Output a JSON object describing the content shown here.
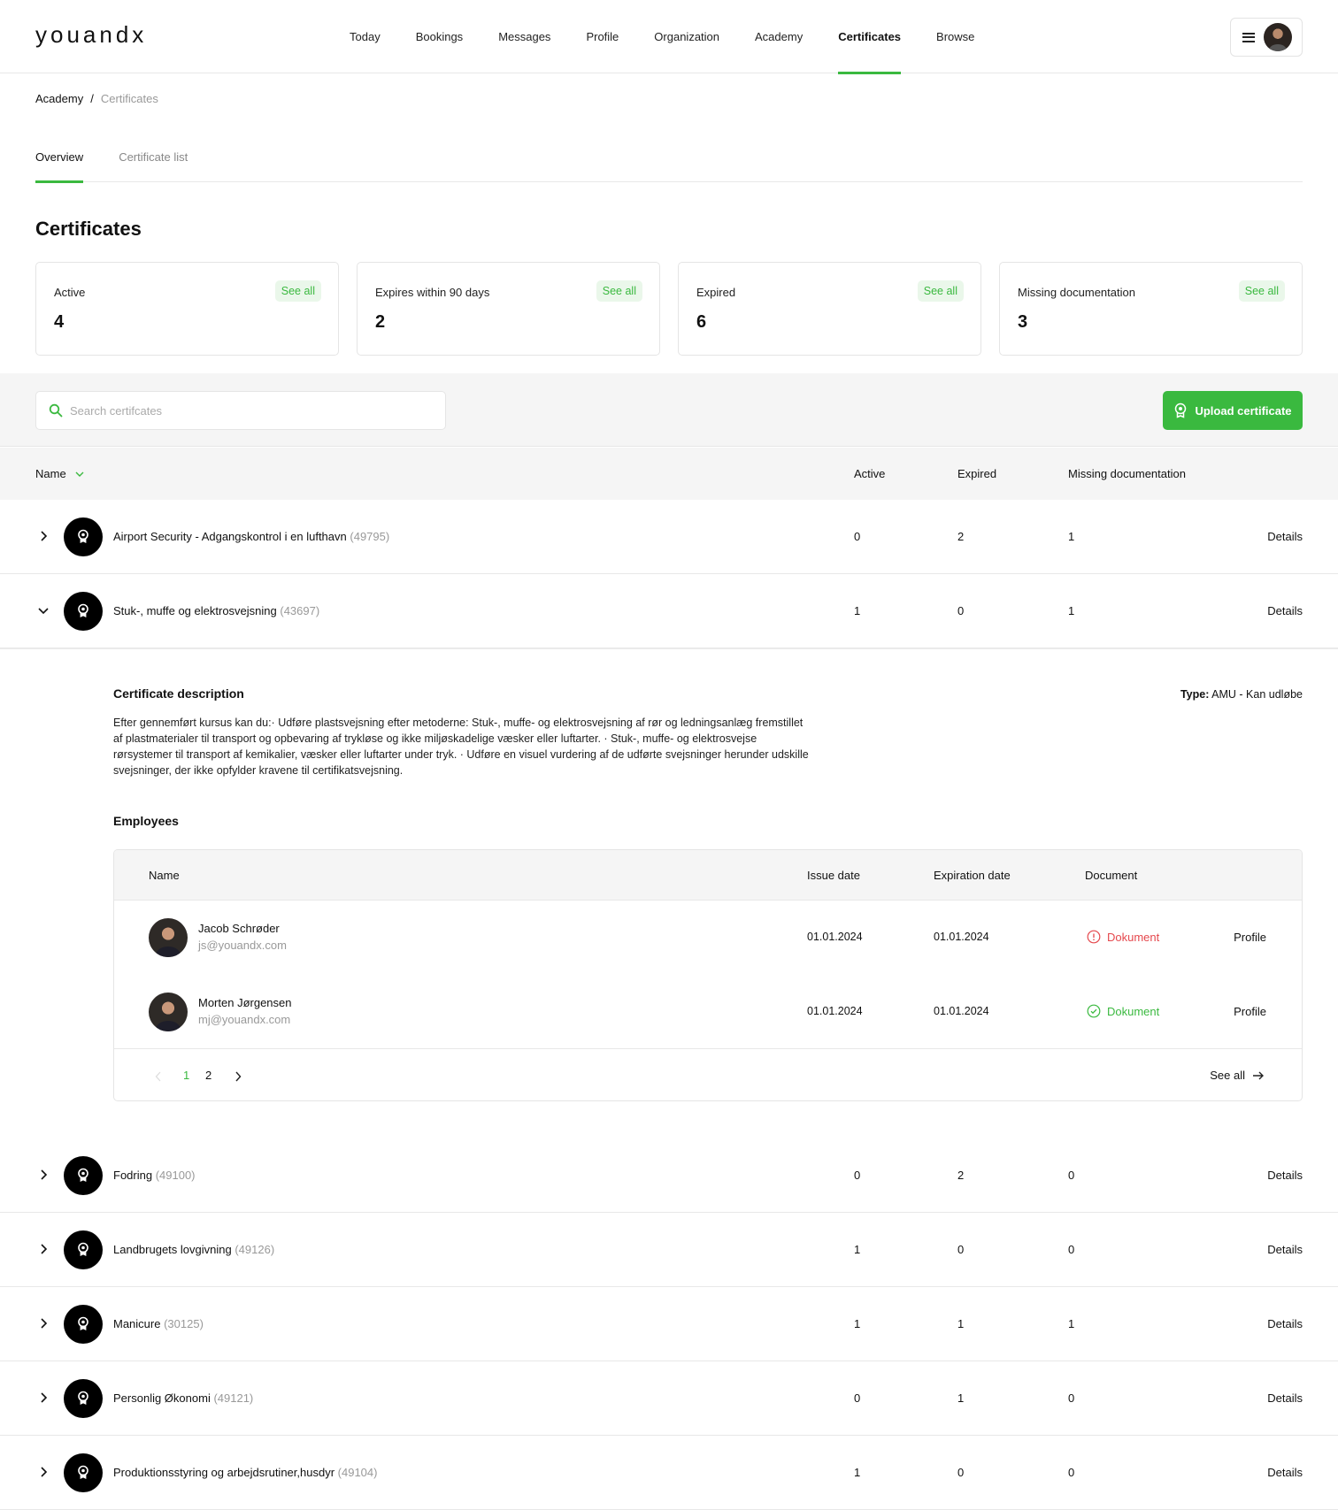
{
  "app": {
    "logo": "youandx"
  },
  "nav": {
    "items": [
      {
        "label": "Today"
      },
      {
        "label": "Bookings"
      },
      {
        "label": "Messages"
      },
      {
        "label": "Profile"
      },
      {
        "label": "Organization"
      },
      {
        "label": "Academy"
      },
      {
        "label": "Certificates",
        "active": true
      },
      {
        "label": "Browse"
      }
    ]
  },
  "breadcrumb": {
    "parent": "Academy",
    "separator": "/",
    "current": "Certificates"
  },
  "tabs": [
    {
      "label": "Overview",
      "active": true
    },
    {
      "label": "Certificate list"
    }
  ],
  "page": {
    "title": "Certificates"
  },
  "cards": [
    {
      "label": "Active",
      "value": "4",
      "link": "See all"
    },
    {
      "label": "Expires within 90 days",
      "value": "2",
      "link": "See all"
    },
    {
      "label": "Expired",
      "value": "6",
      "link": "See all"
    },
    {
      "label": "Missing documentation",
      "value": "3",
      "link": "See all"
    }
  ],
  "search": {
    "placeholder": "Search certifcates",
    "value": ""
  },
  "upload_button": {
    "label": "Upload certificate"
  },
  "table": {
    "headers": {
      "name": "Name",
      "active": "Active",
      "expired": "Expired",
      "missing": "Missing documentation"
    },
    "details_label": "Details",
    "rows": [
      {
        "title": "Airport Security - Adgangskontrol i en lufthavn",
        "code": "(49795)",
        "active": "0",
        "expired": "2",
        "missing": "1",
        "expanded": false
      },
      {
        "title": "Stuk-, muffe og elektrosvejsning",
        "code": "(43697)",
        "active": "1",
        "expired": "0",
        "missing": "1",
        "expanded": true
      },
      {
        "title": "Fodring",
        "code": "(49100)",
        "active": "0",
        "expired": "2",
        "missing": "0",
        "expanded": false
      },
      {
        "title": "Landbrugets lovgivning",
        "code": "(49126)",
        "active": "1",
        "expired": "0",
        "missing": "0",
        "expanded": false
      },
      {
        "title": "Manicure",
        "code": "(30125)",
        "active": "1",
        "expired": "1",
        "missing": "1",
        "expanded": false
      },
      {
        "title": "Personlig Økonomi",
        "code": "(49121)",
        "active": "0",
        "expired": "1",
        "missing": "0",
        "expanded": false
      },
      {
        "title": "Produktionsstyring og arbejdsrutiner,husdyr",
        "code": "(49104)",
        "active": "1",
        "expired": "0",
        "missing": "0",
        "expanded": false
      }
    ]
  },
  "expanded": {
    "desc_title": "Certificate description",
    "type_label": "Type:",
    "type_value": "AMU - Kan udløbe",
    "description": "Efter gennemført kursus kan du:· Udføre plastsvejsning efter metoderne: Stuk-, muffe- og elektrosvejsning af rør og ledningsanlæg fremstillet af plastmaterialer til transport og opbevaring af trykløse og ikke miljøskadelige væsker eller luftarter. · Stuk-, muffe- og elektrosvejse rørsystemer til transport af kemikalier, væsker eller luftarter under tryk. · Udføre en visuel vurdering af de udførte svejsninger herunder udskille svejsninger, der ikke opfylder kravene til certifikatsvejsning.",
    "employees_title": "Employees",
    "employee_headers": {
      "name": "Name",
      "issue": "Issue date",
      "expiration": "Expiration date",
      "document": "Document"
    },
    "employees": [
      {
        "name": "Jacob Schrøder",
        "email": "js@youandx.com",
        "issue": "01.01.2024",
        "expiration": "01.01.2024",
        "document": "Dokument",
        "doc_status": "missing",
        "doc_color": "#e5484d",
        "action": "Profile"
      },
      {
        "name": "Morten Jørgensen",
        "email": "mj@youandx.com",
        "issue": "01.01.2024",
        "expiration": "01.01.2024",
        "document": "Dokument",
        "doc_status": "ok",
        "doc_color": "#3ab93f",
        "action": "Profile"
      }
    ],
    "pagination": {
      "pages": [
        "1",
        "2"
      ],
      "current": "1"
    },
    "see_all": "See all"
  },
  "colors": {
    "accent": "#3ab93f",
    "accent_soft": "#eaf7ea",
    "error": "#e5484d"
  }
}
